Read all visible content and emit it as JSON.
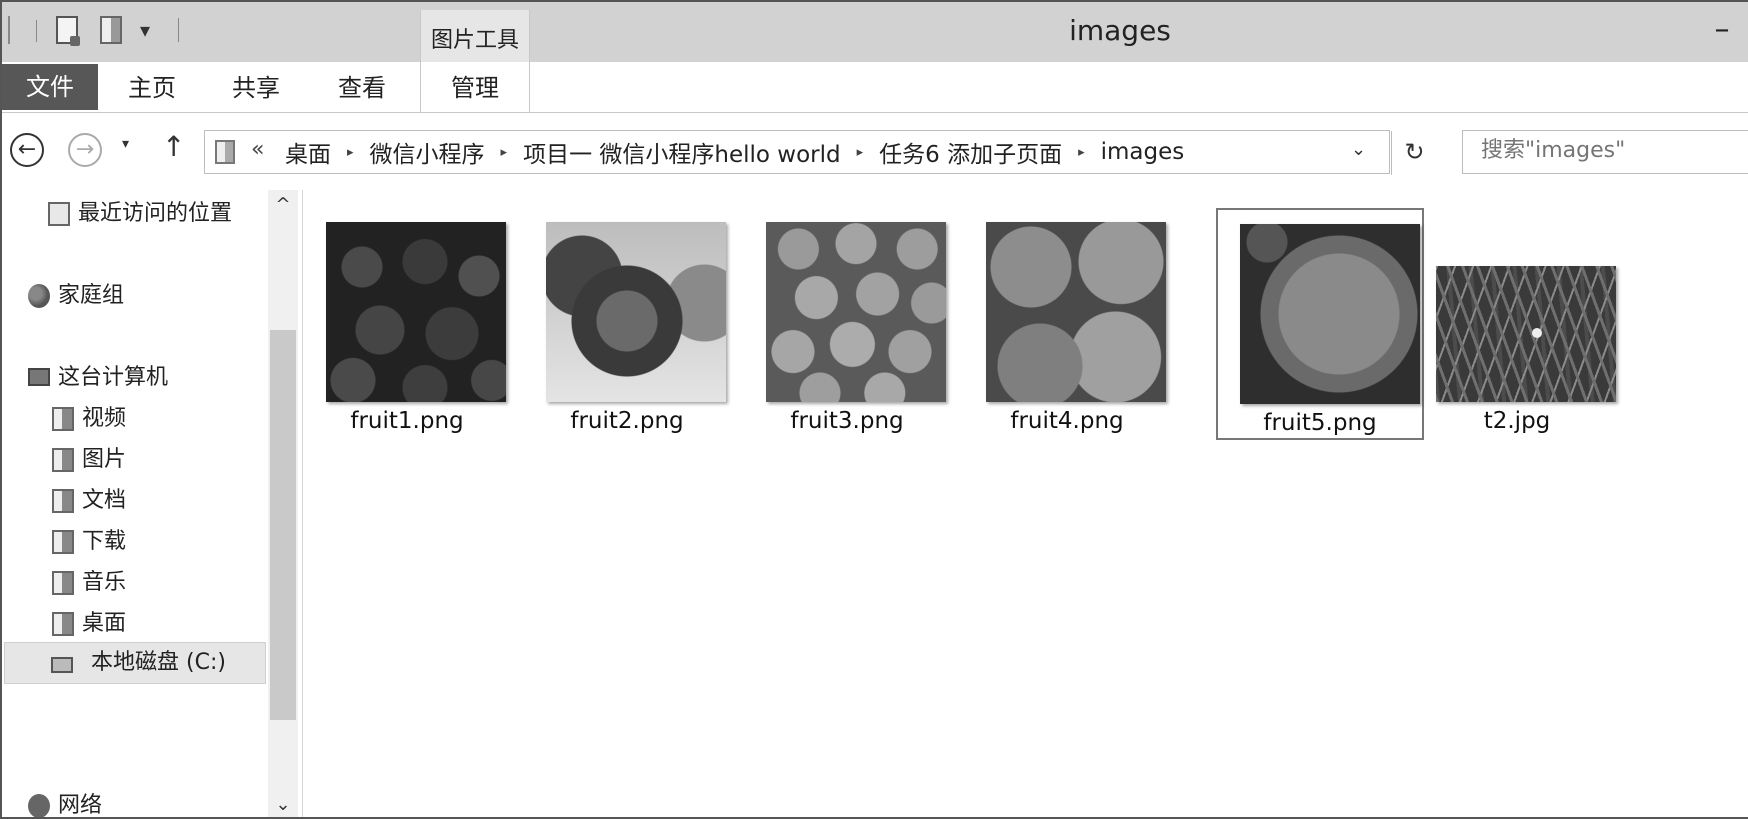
{
  "window": {
    "title": "images",
    "context_tab": "图片工具",
    "minimize_glyph": "–",
    "quick_access": {
      "dropdown_glyph": "▾"
    }
  },
  "ribbon": {
    "tabs": [
      {
        "label": "文件"
      },
      {
        "label": "主页"
      },
      {
        "label": "共享"
      },
      {
        "label": "查看"
      },
      {
        "label": "管理"
      }
    ]
  },
  "nav": {
    "back_glyph": "←",
    "forward_glyph": "→",
    "recent_glyph": "▾",
    "up_glyph": "↑",
    "overflow_glyph": "«",
    "separator_glyph": "▸",
    "dropdown_glyph": "⌄",
    "refresh_glyph": "↻",
    "breadcrumbs": [
      "桌面",
      "微信小程序",
      "项目一 微信小程序hello world",
      "任务6 添加子页面",
      "images"
    ]
  },
  "search": {
    "placeholder": "搜索\"images\""
  },
  "sidebar": {
    "items": [
      {
        "label": "最近访问的位置",
        "icon": "recent-places-icon"
      },
      {
        "label": "家庭组",
        "icon": "homegroup-icon"
      },
      {
        "label": "这台计算机",
        "icon": "computer-icon"
      },
      {
        "label": "视频",
        "icon": "folder-icon"
      },
      {
        "label": "图片",
        "icon": "folder-icon"
      },
      {
        "label": "文档",
        "icon": "folder-icon"
      },
      {
        "label": "下载",
        "icon": "folder-icon"
      },
      {
        "label": "音乐",
        "icon": "folder-icon"
      },
      {
        "label": "桌面",
        "icon": "folder-icon"
      },
      {
        "label": "本地磁盘 (C:)",
        "icon": "drive-icon"
      },
      {
        "label": "网络",
        "icon": "network-icon"
      }
    ],
    "scroll_up_glyph": "^",
    "scroll_down_glyph": "⌄"
  },
  "files": [
    {
      "name": "fruit1.png",
      "selected": false
    },
    {
      "name": "fruit2.png",
      "selected": false
    },
    {
      "name": "fruit3.png",
      "selected": false
    },
    {
      "name": "fruit4.png",
      "selected": false
    },
    {
      "name": "fruit5.png",
      "selected": true
    },
    {
      "name": "t2.jpg",
      "selected": false
    }
  ]
}
